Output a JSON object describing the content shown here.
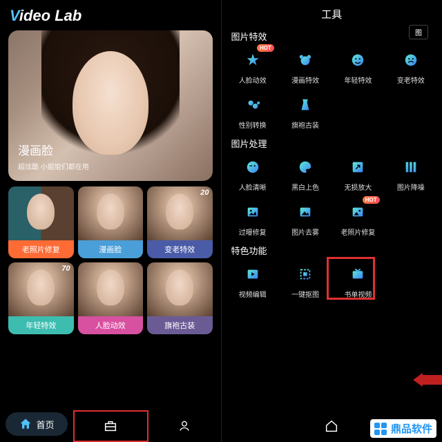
{
  "logo": {
    "pre": "V",
    "mid": "ideo Lab"
  },
  "hero": {
    "title": "漫画脸",
    "sub": "超炫酷 小姐姐们都在用"
  },
  "cards": [
    {
      "label": "老照片修复",
      "badge": ""
    },
    {
      "label": "漫画脸",
      "badge": ""
    },
    {
      "label": "变老特效",
      "badge": "20"
    },
    {
      "label": "年轻特效",
      "badge": "70"
    },
    {
      "label": "人脸动效",
      "badge": ""
    },
    {
      "label": "旗袍古装",
      "badge": ""
    }
  ],
  "nav": {
    "home": "首页"
  },
  "right": {
    "title": "工具",
    "tag": "图",
    "sections": {
      "s1": "图片特效",
      "s2": "图片处理",
      "s3": "特色功能"
    },
    "tools1": [
      {
        "l": "人脸动效",
        "hot": true
      },
      {
        "l": "漫画特效"
      },
      {
        "l": "年轻特效"
      },
      {
        "l": "变老特效"
      },
      {
        "l": "性别转换"
      },
      {
        "l": "旗袍古装"
      }
    ],
    "tools2": [
      {
        "l": "人脸清晰"
      },
      {
        "l": "黑白上色"
      },
      {
        "l": "无损放大"
      },
      {
        "l": "图片降噪"
      },
      {
        "l": "过曝修复"
      },
      {
        "l": "图片去雾"
      },
      {
        "l": "老照片修复",
        "hot": true
      }
    ],
    "tools3": [
      {
        "l": "视频编辑"
      },
      {
        "l": "一键抠图"
      },
      {
        "l": "书单视频"
      }
    ],
    "hotLabel": "HOT"
  },
  "watermark": "鼎品软件"
}
